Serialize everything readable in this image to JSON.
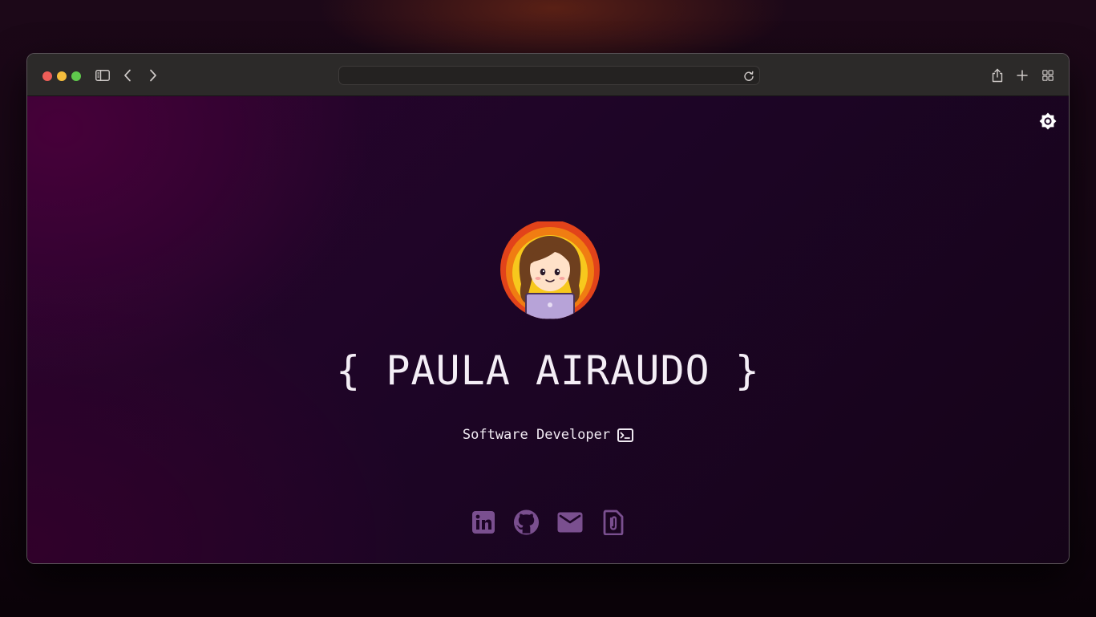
{
  "browser": {
    "url": "",
    "icons": [
      "sidebar-icon",
      "back-icon",
      "forward-icon",
      "reload-icon",
      "share-icon",
      "new-tab-icon",
      "tab-overview-icon"
    ]
  },
  "page": {
    "name": "{ PAULA AIRAUDO }",
    "subtitle": "Software Developer",
    "subtitle_icon": "terminal-icon",
    "theme_toggle_icon": "brightness-icon",
    "social_links": [
      {
        "icon": "linkedin-icon"
      },
      {
        "icon": "github-icon"
      },
      {
        "icon": "email-icon"
      },
      {
        "icon": "resume-attachment-icon"
      }
    ]
  },
  "colors": {
    "accent_icon": "#7a4f8f",
    "text": "#f4eef6",
    "background_dark": "#150418",
    "background_magenta": "#48003a",
    "toolbar": "#2c2a29"
  }
}
